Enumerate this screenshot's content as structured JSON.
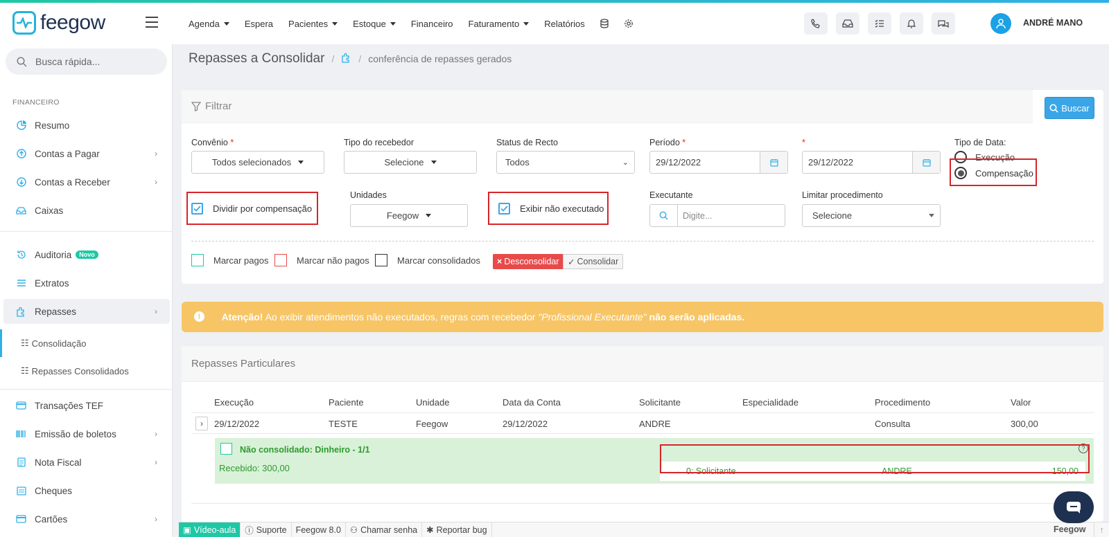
{
  "app": {
    "logo_text": "feegow",
    "user_name": "ANDRÉ MANO",
    "accent": "#2fb0e6"
  },
  "menu": [
    {
      "label": "Agenda",
      "dropdown": true
    },
    {
      "label": "Espera",
      "dropdown": false
    },
    {
      "label": "Pacientes",
      "dropdown": true
    },
    {
      "label": "Estoque",
      "dropdown": true
    },
    {
      "label": "Financeiro",
      "dropdown": false
    },
    {
      "label": "Faturamento",
      "dropdown": true
    },
    {
      "label": "Relatórios",
      "dropdown": false
    }
  ],
  "sidebar": {
    "search_placeholder": "Busca rápida...",
    "section": "FINANCEIRO",
    "items": [
      {
        "label": "Resumo",
        "icon": "pie-chart-icon"
      },
      {
        "label": "Contas a Pagar",
        "icon": "arrow-up-circle-icon"
      },
      {
        "label": "Contas a Receber",
        "icon": "arrow-down-circle-icon"
      },
      {
        "label": "Caixas",
        "icon": "inbox-icon"
      },
      {
        "label": "Auditoria",
        "icon": "history-icon",
        "badge": "Novo"
      },
      {
        "label": "Extratos",
        "icon": "list-icon"
      },
      {
        "label": "Repasses",
        "icon": "puzzle-icon"
      },
      {
        "label": "Transações TEF",
        "icon": "credit-card-icon"
      },
      {
        "label": "Emissão de boletos",
        "icon": "barcode-icon"
      },
      {
        "label": "Nota Fiscal",
        "icon": "document-icon"
      },
      {
        "label": "Cheques",
        "icon": "check-icon"
      },
      {
        "label": "Cartões",
        "icon": "card-icon"
      }
    ],
    "sub_items": [
      "Consolidação",
      "Repasses Consolidados"
    ]
  },
  "breadcrumb": {
    "title": "Repasses a Consolidar",
    "sub": "conferência de repasses gerados"
  },
  "filter": {
    "title": "Filtrar",
    "search_button": "Buscar",
    "convenio_label": "Convênio",
    "convenio_value": "Todos selecionados",
    "tipo_recebedor_label": "Tipo do recebedor",
    "tipo_recebedor_value": "Selecione",
    "status_label": "Status de Recto",
    "status_value": "Todos",
    "periodo_label": "Período",
    "periodo_start": "29/12/2022",
    "periodo_end": "29/12/2022",
    "tipo_data_label": "Tipo de Data:",
    "tipo_data_options": [
      "Execução",
      "Compensação"
    ],
    "tipo_data_selected": "Compensação",
    "dividir_label": "Dividir por compensação",
    "unidades_label": "Unidades",
    "unidades_value": "Feegow",
    "exibir_label": "Exibir não executado",
    "executante_label": "Executante",
    "executante_placeholder": "Digite...",
    "limitar_label": "Limitar procedimento",
    "limitar_value": "Selecione",
    "marcar_pagos": "Marcar pagos",
    "marcar_nao_pagos": "Marcar não pagos",
    "marcar_consolidados": "Marcar consolidados",
    "desconsolidar": "Desconsolidar",
    "consolidar": "Consolidar"
  },
  "alert": {
    "strong": "Atenção!",
    "text": " Ao exibir atendimentos não executados, regras com recebedor ",
    "em": "\"Profissional Executante\"",
    "end": " não serão aplicadas."
  },
  "repasses": {
    "title": "Repasses Particulares",
    "columns": [
      "Execução",
      "Paciente",
      "Unidade",
      "Data da Conta",
      "Solicitante",
      "Especialidade",
      "Procedimento",
      "Valor"
    ],
    "row": {
      "execucao": "29/12/2022",
      "paciente": "TESTE",
      "unidade": "Feegow",
      "data_conta": "29/12/2022",
      "solicitante": "ANDRE",
      "especialidade": "",
      "procedimento": "Consulta",
      "valor": "300,00"
    },
    "status": "Não consolidado: Dinheiro - 1/1",
    "recebido": "Recebido: 300,00",
    "split": {
      "label": "0: Solicitante",
      "name": "ANDRE",
      "value": "150,00"
    }
  },
  "footer": {
    "video": "Vídeo-aula",
    "suporte": "Suporte",
    "version": "Feegow 8.0",
    "chamar": "Chamar senha",
    "bug": "Reportar bug",
    "brand": "Feegow"
  }
}
